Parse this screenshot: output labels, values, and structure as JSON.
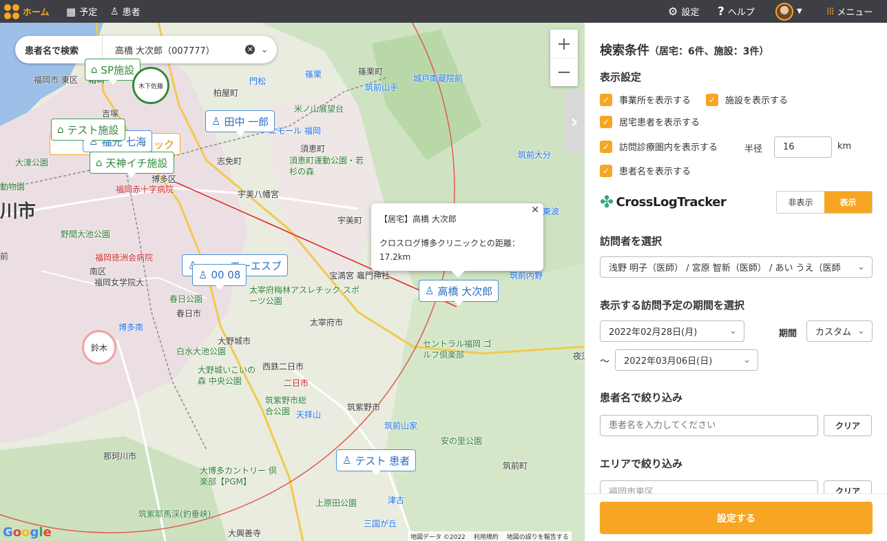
{
  "topbar": {
    "home": "ホーム",
    "schedule": "予定",
    "patients": "患者",
    "settings": "設定",
    "help": "ヘルプ",
    "menu": "メニュー"
  },
  "search": {
    "mode": "患者名で検索",
    "value": "高橋 大次郎（007777）"
  },
  "map": {
    "places": [
      "福岡市 東区",
      "箱崎",
      "吉塚",
      "柏屋町",
      "篠栗町",
      "篠栗",
      "城戸南蔵院前",
      "筑前山手",
      "門松",
      "米ノ山展望台",
      "ニモール 福岡",
      "須恵町",
      "須恵町運動公園・若杉の森",
      "志免町",
      "宇美八幡宮",
      "宇美町",
      "博多区",
      "福岡赤十字病院",
      "動物園",
      "大濠公園",
      "野間大池公園",
      "福岡徳洲会病院",
      "南区",
      "福岡女学院大",
      "春日公園",
      "春日市",
      "博多南",
      "大野城市",
      "白水大池公園",
      "大野城いこいの森 中央公園",
      "西鉄二日市",
      "二日市",
      "筑紫野市総合公園",
      "天拝山",
      "筑紫野市",
      "筑前山家",
      "宝満宮 竈門神社",
      "太宰府梅林アスレチック スポーツ公園",
      "太宰府市",
      "セントラル福岡 ゴルフ倶楽部",
      "安の里公園",
      "筑前町",
      "那珂川市",
      "大博多カントリー 倶楽部【PGM】",
      "筑紫耶馬渓(釣垂峡)",
      "上原田公園",
      "津古",
      "三国が丘",
      "大興善寺",
      "筑前大分",
      "筑前内野",
      "東波",
      "夜須",
      "川市",
      "天神",
      "前"
    ],
    "google": "Google",
    "attribution": [
      "地図データ ©2022",
      "利用規約",
      "地図の誤りを報告する"
    ]
  },
  "markers": {
    "sp": "SP施設",
    "test_facility": "テスト施設",
    "kinoshita": "木下佐藤",
    "tanaka": "田中 一郎",
    "fukumitsu": "福光 七海",
    "clinic": "ニック",
    "tenjin": "天神イチ施設",
    "eszu": "エーエスブ",
    "hundreds": "00 08",
    "takahashi": "高橋 大次郎",
    "test_patient": "テスト 患者",
    "suzuki": "鈴木"
  },
  "popup": {
    "title": "【居宅】高橋 大次郎",
    "body": "クロスログ博多クリニックとの距離：17.2km"
  },
  "panel": {
    "title": "検索条件",
    "count": "（居宅：6件、施設：3件）",
    "display_settings": "表示設定",
    "opt_office": "事業所を表示する",
    "opt_facility": "施設を表示する",
    "opt_home": "居宅患者を表示する",
    "opt_range": "訪問診療圏内を表示する",
    "radius_label": "半径",
    "radius_value": "16",
    "radius_unit": "km",
    "opt_names": "患者名を表示する",
    "crosslog": "CrossLogTracker",
    "hide": "非表示",
    "show": "表示",
    "visitor_label": "訪問者を選択",
    "visitor_value": "浅野 明子（医師） / 宮原 智新（医師） / あい うえ（医師",
    "period_label": "表示する訪問予定の期間を選択",
    "date_from": "2022年02月28日(月)",
    "period_word": "期間",
    "period_value": "カスタム",
    "tilde": "〜",
    "date_to": "2022年03月06日(日)",
    "name_filter_label": "患者名で絞り込み",
    "name_placeholder": "患者名を入力してください",
    "clear": "クリア",
    "area_filter_label": "エリアで絞り込み",
    "area_value": "福岡市東区",
    "submit": "設定する"
  }
}
